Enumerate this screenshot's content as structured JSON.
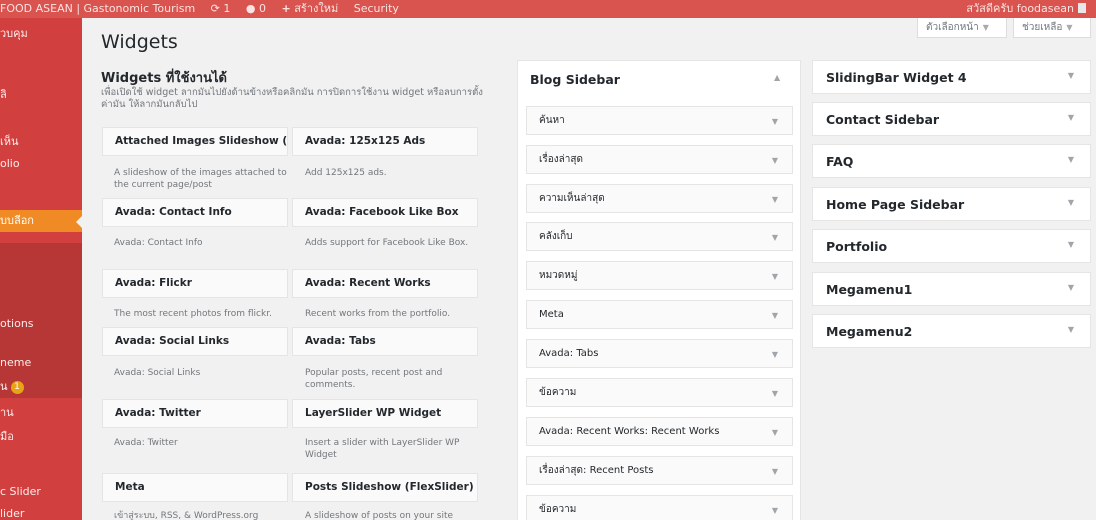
{
  "adminbar": {
    "site_name": "FOOD ASEAN | Gastonomic Tourism",
    "updates_count": "1",
    "comments_count": "0",
    "new_label": "สร้างใหม่",
    "security_label": "Security",
    "greeting": "สวัสดีครับ foodasean"
  },
  "menu": {
    "items": [
      {
        "label": "วบคุม"
      },
      {
        "label": "ลิ"
      },
      {
        "label": "เห็น"
      },
      {
        "label": "olio"
      },
      {
        "label": "บบลีอก"
      },
      {
        "label": "otions"
      },
      {
        "label": "neme"
      },
      {
        "label": "น",
        "count": "1"
      },
      {
        "label": "าน"
      },
      {
        "label": "มือ"
      },
      {
        "label": "c Slider"
      },
      {
        "label": "lider"
      }
    ]
  },
  "page": {
    "title": "Widgets",
    "screen_options": "ตัวเลือกหน้า",
    "help": "ช่วยเหลือ"
  },
  "available": {
    "heading": "Widgets ที่ใช้งานได้",
    "description": "เพื่อเปิดใช้ widget ลากมันไปยังด้านข้างหรือคลิกมัน การปิดการใช้งาน widget หรือลบการตั้งค่ามัน ให้ลากมันกลับไป",
    "widgets": [
      {
        "title": "Attached Images Slideshow (...",
        "desc": "A slideshow of the images attached to the current page/post"
      },
      {
        "title": "Avada: 125x125 Ads",
        "desc": "Add 125x125 ads."
      },
      {
        "title": "Avada: Contact Info",
        "desc": "Avada: Contact Info"
      },
      {
        "title": "Avada: Facebook Like Box",
        "desc": "Adds support for Facebook Like Box."
      },
      {
        "title": "Avada: Flickr",
        "desc": "The most recent photos from flickr."
      },
      {
        "title": "Avada: Recent Works",
        "desc": "Recent works from the portfolio."
      },
      {
        "title": "Avada: Social Links",
        "desc": "Avada: Social Links"
      },
      {
        "title": "Avada: Tabs",
        "desc": "Popular posts, recent post and comments."
      },
      {
        "title": "Avada: Twitter",
        "desc": "Avada: Twitter"
      },
      {
        "title": "LayerSlider WP Widget",
        "desc": "Insert a slider with LayerSlider WP Widget"
      },
      {
        "title": "Meta",
        "desc": "เข้าสู่ระบบ, RSS, & WordPress.org"
      },
      {
        "title": "Posts Slideshow (FlexSlider)",
        "desc": "A slideshow of posts on your site"
      }
    ]
  },
  "blog_sidebar": {
    "title": "Blog Sidebar",
    "widgets": [
      {
        "title": "ค้นหา",
        "sub": ""
      },
      {
        "title": "เรื่องล่าสุด",
        "sub": ""
      },
      {
        "title": "ความเห็นล่าสุด",
        "sub": ""
      },
      {
        "title": "คลังเก็บ",
        "sub": ""
      },
      {
        "title": "หมวดหมู่",
        "sub": ""
      },
      {
        "title": "Meta",
        "sub": ""
      },
      {
        "title": "Avada: Tabs",
        "sub": ""
      },
      {
        "title": "ข้อความ",
        "sub": ""
      },
      {
        "title": "Avada: Recent Works:",
        "sub": "Recent Works"
      },
      {
        "title": "เรื่องล่าสุด:",
        "sub": "Recent Posts"
      },
      {
        "title": "ข้อความ",
        "sub": ""
      }
    ]
  },
  "other_sidebars": [
    {
      "title": "SlidingBar Widget 4"
    },
    {
      "title": "Contact Sidebar"
    },
    {
      "title": "FAQ"
    },
    {
      "title": "Home Page Sidebar"
    },
    {
      "title": "Portfolio"
    },
    {
      "title": "Megamenu1"
    },
    {
      "title": "Megamenu2"
    }
  ],
  "colors": {
    "adminbar": "#d9534f",
    "menu": "#d13f3f",
    "menu_active": "#f08a24"
  }
}
